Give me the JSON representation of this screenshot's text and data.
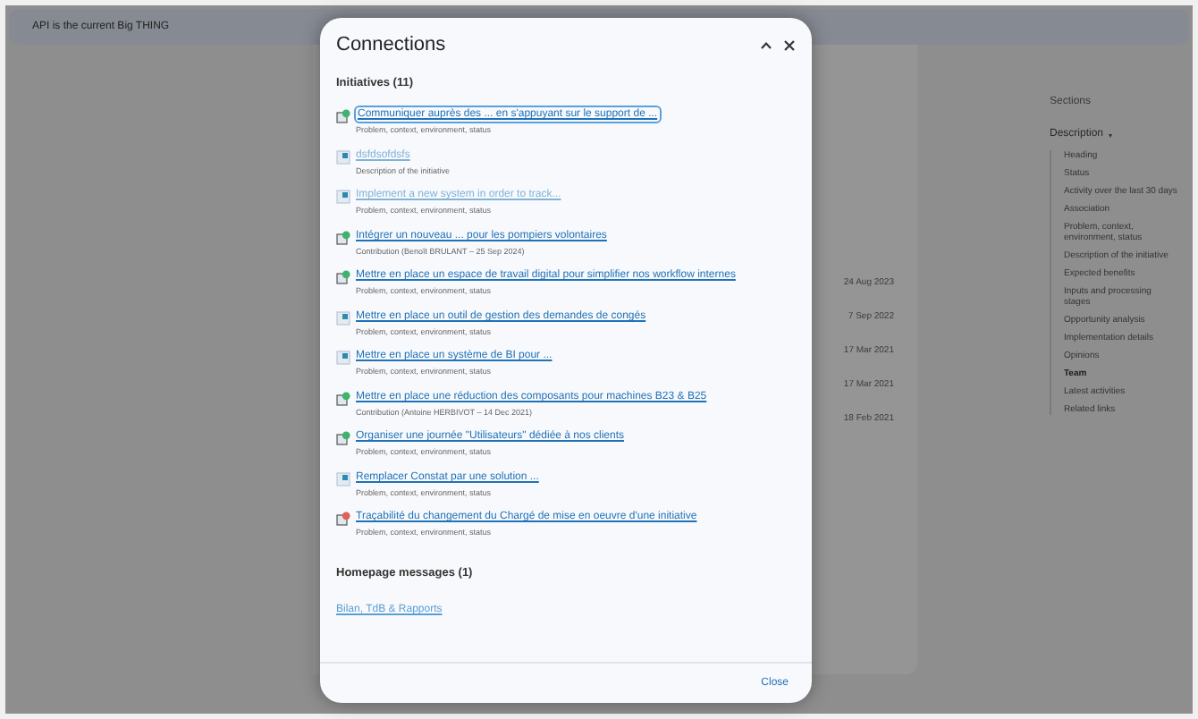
{
  "banner": {
    "text": "API is the current Big THING"
  },
  "background_dates": [
    "24 Aug 2023",
    "7 Sep 2022",
    "17 Mar 2021",
    "17 Mar 2021",
    "18 Feb 2021"
  ],
  "sections_nav": {
    "title": "Sections",
    "group": {
      "label": "Description",
      "expanded": true
    },
    "items": [
      {
        "label": "Heading",
        "selected": false
      },
      {
        "label": "Status",
        "selected": false
      },
      {
        "label": "Activity over the last 30 days",
        "selected": false
      },
      {
        "label": "Association",
        "selected": false
      },
      {
        "label": "Problem, context, environment, status",
        "selected": false
      },
      {
        "label": "Description of the initiative",
        "selected": false
      },
      {
        "label": "Expected benefits",
        "selected": false
      },
      {
        "label": "Inputs and processing stages",
        "selected": false
      },
      {
        "label": "Opportunity analysis",
        "selected": false
      },
      {
        "label": "Implementation details",
        "selected": false
      },
      {
        "label": "Opinions",
        "selected": false
      },
      {
        "label": "Team",
        "selected": true
      },
      {
        "label": "Latest activities",
        "selected": false
      },
      {
        "label": "Related links",
        "selected": false
      }
    ]
  },
  "dialog": {
    "title": "Connections",
    "initiatives": {
      "heading": "Initiatives (11)",
      "items": [
        {
          "kind": "approved",
          "title": "Communiquer auprès des ... en s'appuyant sur le support de ...",
          "subtitle": "Problem, context, environment, status",
          "faded": false,
          "focused": true
        },
        {
          "kind": "draft",
          "title": "dsfdsofdsfs",
          "subtitle": "Description of the initiative",
          "faded": true,
          "focused": false
        },
        {
          "kind": "draft",
          "title": "Implement a new system in order to track...",
          "subtitle": "Problem, context, environment, status",
          "faded": true,
          "focused": false
        },
        {
          "kind": "approved",
          "title": "Intégrer un nouveau ... pour les pompiers volontaires",
          "subtitle": "Contribution (Benoît BRULANT – 25 Sep 2024)",
          "faded": false,
          "focused": false
        },
        {
          "kind": "approved",
          "title": "Mettre en place un espace de travail digital pour simplifier nos workflow internes",
          "subtitle": "Problem, context, environment, status",
          "faded": false,
          "focused": false
        },
        {
          "kind": "draft",
          "title": "Mettre en place un outil de gestion des demandes de congés",
          "subtitle": "Problem, context, environment, status",
          "faded": false,
          "focused": false
        },
        {
          "kind": "draft",
          "title": "Mettre en place un système de BI pour ...",
          "subtitle": "Problem, context, environment, status",
          "faded": false,
          "focused": false
        },
        {
          "kind": "approved",
          "title": "Mettre en place une réduction des composants pour machines B23 & B25",
          "subtitle": "Contribution (Antoine HERBIVOT – 14 Dec 2021)",
          "faded": false,
          "focused": false
        },
        {
          "kind": "approved",
          "title": "Organiser une journée \"Utilisateurs\" dédiée à nos clients",
          "subtitle": "Problem, context, environment, status",
          "faded": false,
          "focused": false
        },
        {
          "kind": "draft",
          "title": "Remplacer Constat par une solution ...",
          "subtitle": "Problem, context, environment, status",
          "faded": false,
          "focused": false
        },
        {
          "kind": "rejected",
          "title": "Traçabilité du changement du Chargé de mise en oeuvre d'une initiative",
          "subtitle": "Problem, context, environment, status",
          "faded": false,
          "focused": false
        }
      ]
    },
    "homepage_messages": {
      "heading": "Homepage messages (1)",
      "items": [
        {
          "title": "Bilan, TdB & Rapports"
        }
      ]
    },
    "close_button": "Close"
  }
}
